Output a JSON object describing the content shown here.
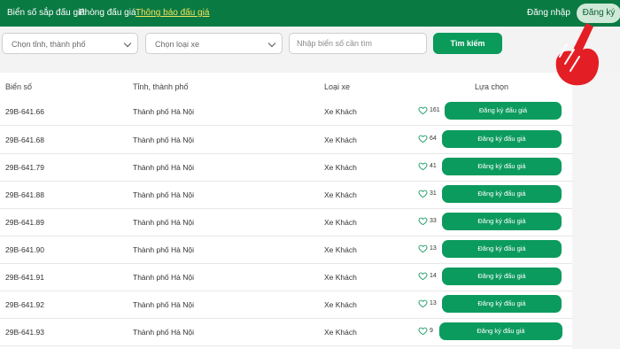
{
  "nav": {
    "items": [
      {
        "label": "Biển số sắp đấu giá",
        "active": false
      },
      {
        "label": "Phòng đấu giá",
        "active": false
      },
      {
        "label": "Thông báo đấu giá",
        "active": true
      }
    ],
    "login": "Đăng nhập",
    "register": "Đăng ký"
  },
  "filters": {
    "province_placeholder": "Chọn tỉnh, thành phố",
    "vehicle_placeholder": "Chọn loại xe",
    "plate_placeholder": "Nhập biển số cần tìm",
    "search_button": "Tìm kiếm"
  },
  "table": {
    "headers": {
      "plate": "Biển số",
      "province": "Tỉnh, thành phố",
      "type": "Loại xe",
      "choice": "Lựa chọn"
    },
    "register_label": "Đăng ký đấu giá",
    "rows": [
      {
        "plate": "29B-641.66",
        "province": "Thành phố Hà Nội",
        "type": "Xe Khách",
        "likes": "161"
      },
      {
        "plate": "29B-641.68",
        "province": "Thành phố Hà Nội",
        "type": "Xe Khách",
        "likes": "64"
      },
      {
        "plate": "29B-641.79",
        "province": "Thành phố Hà Nội",
        "type": "Xe Khách",
        "likes": "41"
      },
      {
        "plate": "29B-641.88",
        "province": "Thành phố Hà Nội",
        "type": "Xe Khách",
        "likes": "31"
      },
      {
        "plate": "29B-641.89",
        "province": "Thành phố Hà Nội",
        "type": "Xe Khách",
        "likes": "33"
      },
      {
        "plate": "29B-641.90",
        "province": "Thành phố Hà Nội",
        "type": "Xe Khách",
        "likes": "13"
      },
      {
        "plate": "29B-641.91",
        "province": "Thành phố Hà Nội",
        "type": "Xe Khách",
        "likes": "14"
      },
      {
        "plate": "29B-641.92",
        "province": "Thành phố Hà Nội",
        "type": "Xe Khách",
        "likes": "13"
      },
      {
        "plate": "29B-641.93",
        "province": "Thành phố Hà Nội",
        "type": "Xe Khách",
        "likes": "9"
      }
    ]
  },
  "colors": {
    "header_green": "#0a7a43",
    "button_green": "#0c9b5e",
    "active_nav": "#f4e35a",
    "hand_red": "#e31e24"
  },
  "icons": {
    "heart": "heart-icon",
    "chevron": "chevron-down-icon",
    "pointer": "pointing-hand-icon"
  }
}
